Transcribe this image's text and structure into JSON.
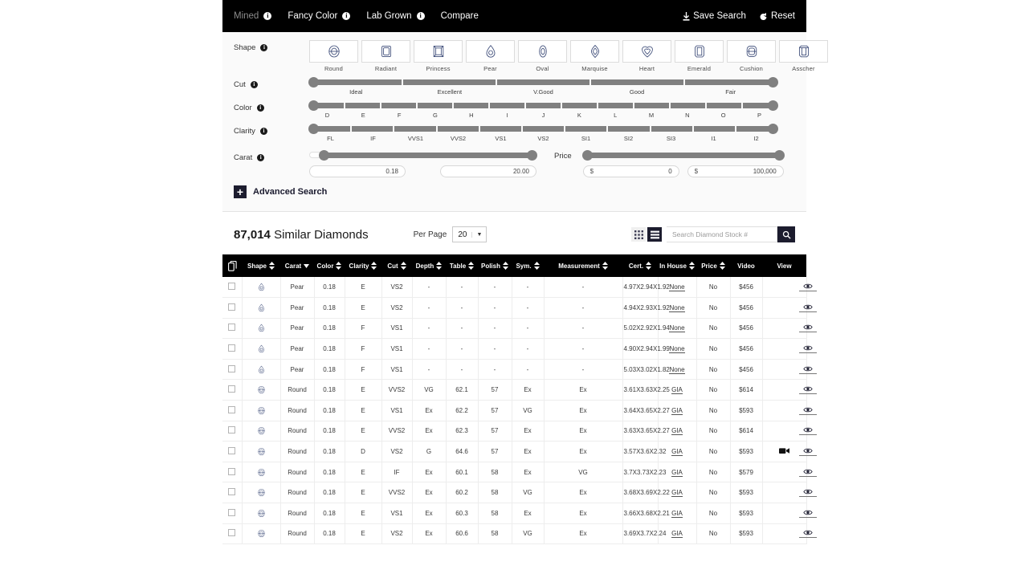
{
  "topnav": {
    "tabs": [
      {
        "label": "Mined",
        "has_info": true,
        "active": true
      },
      {
        "label": "Fancy Color",
        "has_info": true,
        "active": false
      },
      {
        "label": "Lab Grown",
        "has_info": true,
        "active": false
      },
      {
        "label": "Compare",
        "has_info": false,
        "active": false
      }
    ],
    "save_search": "Save Search",
    "reset": "Reset"
  },
  "filters": {
    "shape": {
      "label": "Shape",
      "options": [
        "Round",
        "Radiant",
        "Princess",
        "Pear",
        "Oval",
        "Marquise",
        "Heart",
        "Emerald",
        "Cushion",
        "Asscher"
      ]
    },
    "cut": {
      "label": "Cut",
      "ticks": [
        "Ideal",
        "Excellent",
        "V.Good",
        "Good",
        "Fair"
      ]
    },
    "color": {
      "label": "Color",
      "ticks": [
        "D",
        "E",
        "F",
        "G",
        "H",
        "I",
        "J",
        "K",
        "L",
        "M",
        "N",
        "O",
        "P"
      ]
    },
    "clarity": {
      "label": "Clarity",
      "ticks": [
        "FL",
        "IF",
        "VVS1",
        "VVS2",
        "VS1",
        "VS2",
        "SI1",
        "SI2",
        "SI3",
        "I1",
        "I2"
      ]
    },
    "carat": {
      "label": "Carat",
      "min": "0.18",
      "max": "20.00"
    },
    "price": {
      "label": "Price",
      "currency": "$",
      "min": "0",
      "max": "100,000"
    },
    "advanced_search": "Advanced Search"
  },
  "results": {
    "count": "87,014",
    "count_suffix": "Similar Diamonds",
    "per_page_label": "Per Page",
    "per_page_value": "20",
    "search_placeholder": "Search Diamond Stock #"
  },
  "table": {
    "columns": [
      {
        "key": "check",
        "label": "",
        "sortable": false
      },
      {
        "key": "shape",
        "label": "Shape",
        "sortable": true
      },
      {
        "key": "carat",
        "label": "Carat",
        "sortable": true,
        "sorted": "desc"
      },
      {
        "key": "color",
        "label": "Color",
        "sortable": true
      },
      {
        "key": "clarity",
        "label": "Clarity",
        "sortable": true
      },
      {
        "key": "cut",
        "label": "Cut",
        "sortable": true
      },
      {
        "key": "depth",
        "label": "Depth",
        "sortable": true
      },
      {
        "key": "table",
        "label": "Table",
        "sortable": true
      },
      {
        "key": "polish",
        "label": "Polish",
        "sortable": true
      },
      {
        "key": "sym",
        "label": "Sym.",
        "sortable": true
      },
      {
        "key": "measurement",
        "label": "Measurement",
        "sortable": true
      },
      {
        "key": "cert",
        "label": "Cert.",
        "sortable": true
      },
      {
        "key": "inhouse",
        "label": "In House",
        "sortable": true
      },
      {
        "key": "price",
        "label": "Price",
        "sortable": true
      },
      {
        "key": "video",
        "label": "Video",
        "sortable": false
      },
      {
        "key": "view",
        "label": "View",
        "sortable": false
      }
    ],
    "rows": [
      {
        "shape": "Pear",
        "carat": "0.18",
        "color": "E",
        "clarity": "VS2",
        "cut": "-",
        "depth": "-",
        "table": "-",
        "polish": "-",
        "sym": "-",
        "measurement": "4.97X2.94X1.92",
        "cert": "None",
        "inhouse": "No",
        "price": "$456",
        "video": false
      },
      {
        "shape": "Pear",
        "carat": "0.18",
        "color": "E",
        "clarity": "VS2",
        "cut": "-",
        "depth": "-",
        "table": "-",
        "polish": "-",
        "sym": "-",
        "measurement": "4.94X2.93X1.92",
        "cert": "None",
        "inhouse": "No",
        "price": "$456",
        "video": false
      },
      {
        "shape": "Pear",
        "carat": "0.18",
        "color": "F",
        "clarity": "VS1",
        "cut": "-",
        "depth": "-",
        "table": "-",
        "polish": "-",
        "sym": "-",
        "measurement": "5.02X2.92X1.94",
        "cert": "None",
        "inhouse": "No",
        "price": "$456",
        "video": false
      },
      {
        "shape": "Pear",
        "carat": "0.18",
        "color": "F",
        "clarity": "VS1",
        "cut": "-",
        "depth": "-",
        "table": "-",
        "polish": "-",
        "sym": "-",
        "measurement": "4.90X2.94X1.99",
        "cert": "None",
        "inhouse": "No",
        "price": "$456",
        "video": false
      },
      {
        "shape": "Pear",
        "carat": "0.18",
        "color": "F",
        "clarity": "VS1",
        "cut": "-",
        "depth": "-",
        "table": "-",
        "polish": "-",
        "sym": "-",
        "measurement": "5.03X3.02X1.82",
        "cert": "None",
        "inhouse": "No",
        "price": "$456",
        "video": false
      },
      {
        "shape": "Round",
        "carat": "0.18",
        "color": "E",
        "clarity": "VVS2",
        "cut": "VG",
        "depth": "62.1",
        "table": "57",
        "polish": "Ex",
        "sym": "Ex",
        "measurement": "3.61X3.63X2.25",
        "cert": "GIA",
        "inhouse": "No",
        "price": "$614",
        "video": false
      },
      {
        "shape": "Round",
        "carat": "0.18",
        "color": "E",
        "clarity": "VS1",
        "cut": "Ex",
        "depth": "62.2",
        "table": "57",
        "polish": "VG",
        "sym": "Ex",
        "measurement": "3.64X3.65X2.27",
        "cert": "GIA",
        "inhouse": "No",
        "price": "$593",
        "video": false
      },
      {
        "shape": "Round",
        "carat": "0.18",
        "color": "E",
        "clarity": "VVS2",
        "cut": "Ex",
        "depth": "62.3",
        "table": "57",
        "polish": "Ex",
        "sym": "Ex",
        "measurement": "3.63X3.65X2.27",
        "cert": "GIA",
        "inhouse": "No",
        "price": "$614",
        "video": false
      },
      {
        "shape": "Round",
        "carat": "0.18",
        "color": "D",
        "clarity": "VS2",
        "cut": "G",
        "depth": "64.6",
        "table": "57",
        "polish": "Ex",
        "sym": "Ex",
        "measurement": "3.57X3.6X2.32",
        "cert": "GIA",
        "inhouse": "No",
        "price": "$593",
        "video": true
      },
      {
        "shape": "Round",
        "carat": "0.18",
        "color": "E",
        "clarity": "IF",
        "cut": "Ex",
        "depth": "60.1",
        "table": "58",
        "polish": "Ex",
        "sym": "VG",
        "measurement": "3.7X3.73X2.23",
        "cert": "GIA",
        "inhouse": "No",
        "price": "$579",
        "video": false
      },
      {
        "shape": "Round",
        "carat": "0.18",
        "color": "E",
        "clarity": "VVS2",
        "cut": "Ex",
        "depth": "60.2",
        "table": "58",
        "polish": "VG",
        "sym": "Ex",
        "measurement": "3.68X3.69X2.22",
        "cert": "GIA",
        "inhouse": "No",
        "price": "$593",
        "video": false
      },
      {
        "shape": "Round",
        "carat": "0.18",
        "color": "E",
        "clarity": "VS1",
        "cut": "Ex",
        "depth": "60.3",
        "table": "58",
        "polish": "Ex",
        "sym": "Ex",
        "measurement": "3.66X3.68X2.21",
        "cert": "GIA",
        "inhouse": "No",
        "price": "$593",
        "video": false
      },
      {
        "shape": "Round",
        "carat": "0.18",
        "color": "E",
        "clarity": "VS2",
        "cut": "Ex",
        "depth": "60.6",
        "table": "58",
        "polish": "VG",
        "sym": "Ex",
        "measurement": "3.69X3.7X2.24",
        "cert": "GIA",
        "inhouse": "No",
        "price": "$593",
        "video": false
      }
    ]
  },
  "colors": {
    "nav_bg": "#000000",
    "accent_dark": "#1c1c2e",
    "shape_icon": "#3b4a77",
    "slider_track": "#808080",
    "panel_bg": "#fafafa"
  }
}
